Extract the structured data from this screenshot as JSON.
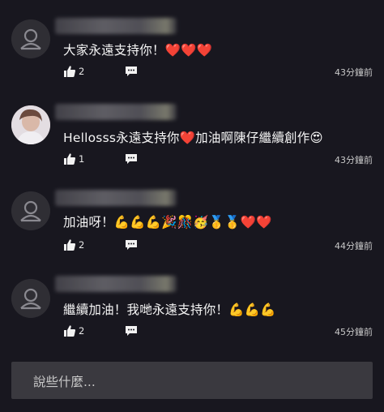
{
  "comments": [
    {
      "text": "大家永遠支持你！❤️❤️❤️",
      "likes": "2",
      "time": "43分鐘前",
      "avatar": "default"
    },
    {
      "text": "Hellosss永遠支持你❤️加油啊陳仔繼續創作😍",
      "likes": "1",
      "time": "43分鐘前",
      "avatar": "photo"
    },
    {
      "text": "加油呀！💪💪💪🎉🎊🥳🥇🥇❤️❤️",
      "likes": "2",
      "time": "44分鐘前",
      "avatar": "default"
    },
    {
      "text": "繼續加油！我哋永遠支持你！💪💪💪",
      "likes": "2",
      "time": "45分鐘前",
      "avatar": "default"
    }
  ],
  "input": {
    "placeholder": "說些什麼..."
  },
  "icons": {
    "like": "thumbs-up-icon",
    "reply": "comment-icon",
    "avatar": "default-avatar-icon"
  }
}
